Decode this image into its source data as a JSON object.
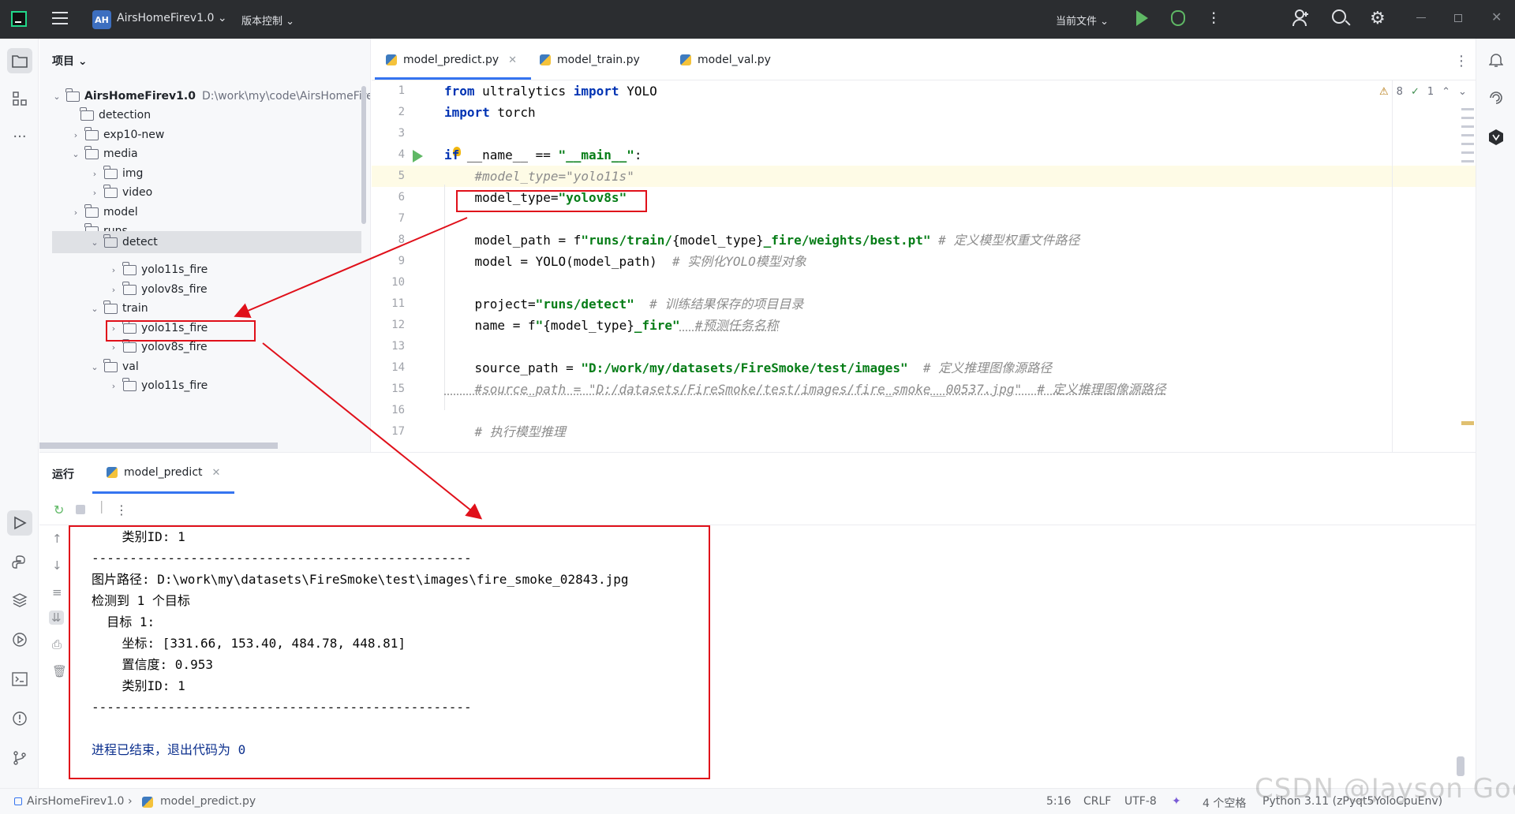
{
  "titlebar": {
    "badge": "AH",
    "project": "AirsHomeFirev1.0 ⌄",
    "vcs": "版本控制 ⌄",
    "current_file": "当前文件 ⌄"
  },
  "project_panel": {
    "header": "项目 ⌄",
    "root_name": "AirsHomeFirev1.0",
    "root_path": "D:\\work\\my\\code\\AirsHomeFire\\",
    "items": [
      {
        "label": "detection"
      },
      {
        "label": "exp10-new"
      },
      {
        "label": "media"
      },
      {
        "label": "img"
      },
      {
        "label": "video"
      },
      {
        "label": "model"
      },
      {
        "label": "runs"
      },
      {
        "label": "detect"
      },
      {
        "label": "yolo11s_fire"
      },
      {
        "label": "yolov8s_fire"
      },
      {
        "label": "train"
      },
      {
        "label": "yolo11s_fire"
      },
      {
        "label": "yolov8s_fire"
      },
      {
        "label": "val"
      },
      {
        "label": "yolo11s_fire"
      }
    ]
  },
  "editor": {
    "tabs": [
      {
        "label": "model_predict.py"
      },
      {
        "label": "model_train.py"
      },
      {
        "label": "model_val.py"
      }
    ],
    "inspections": {
      "warnings": "8",
      "ok": "1"
    },
    "line_numbers": [
      "1",
      "2",
      "3",
      "4",
      "5",
      "6",
      "7",
      "8",
      "9",
      "10",
      "11",
      "12",
      "13",
      "14",
      "15",
      "16",
      "17"
    ],
    "lines": {
      "l1_kw1": "from",
      "l1_mid": " ultralytics ",
      "l1_kw2": "import",
      "l1_end": " YOLO",
      "l2_kw": "import",
      "l2_end": " torch",
      "l4_kw": "if",
      "l4_mid": " __name__ == ",
      "l4_str": "\"__main__\"",
      "l4_end": ":",
      "l5": "    #model_type=\"yolo11s\"",
      "l6_a": "    model_type=",
      "l6_str": "\"yolov8s\"",
      "l8_a": "    model_path = f",
      "l8_s1": "\"runs/train/",
      "l8_b": "{model_type}",
      "l8_s2": "_fire/weights/best.pt\"",
      "l8_c": " # 定义模型权重文件路径",
      "l9_a": "    model = YOLO(model_path)  ",
      "l9_c": "# 实例化YOLO模型对象",
      "l11_a": "    project=",
      "l11_s": "\"runs/detect\"",
      "l11_c": "  # 训练结果保存的项目目录",
      "l12_a": "    name = f",
      "l12_s1": "\"",
      "l12_b": "{model_type}",
      "l12_s2": "_fire\"",
      "l12_c": "  #预测任务名称",
      "l14_a": "    source_path = ",
      "l14_s": "\"D:/work/my/datasets/FireSmoke/test/images\"",
      "l14_c": "  # 定义推理图像源路径",
      "l15": "    #source_path = \"D:/datasets/FireSmoke/test/images/fire_smoke__00537.jpg\"  # 定义推理图像源路径",
      "l17": "    # 执行模型推理"
    }
  },
  "run_panel": {
    "title": "运行",
    "tab": "model_predict",
    "output": [
      "    类别ID: 1",
      "--------------------------------------------------",
      "图片路径: D:\\work\\my\\datasets\\FireSmoke\\test\\images\\fire_smoke_02843.jpg",
      "检测到 1 个目标",
      "  目标 1:",
      "    坐标: [331.66, 153.40, 484.78, 448.81]",
      "    置信度: 0.953",
      "    类别ID: 1",
      "--------------------------------------------------",
      "",
      "进程已结束，退出代码为 0"
    ]
  },
  "statusbar": {
    "project": "AirsHomeFirev1.0",
    "file": "model_predict.py",
    "position": "5:16",
    "line_sep": "CRLF",
    "encoding": "UTF-8",
    "indent": "4 个空格",
    "interpreter": "Python 3.11 (zPyqt5YoloCpuEnv)"
  },
  "watermark": "CSDN @Jayson God",
  "colors": {
    "accent": "#3574f0",
    "annotation": "#e0101a",
    "run_green": "#5fb865"
  }
}
